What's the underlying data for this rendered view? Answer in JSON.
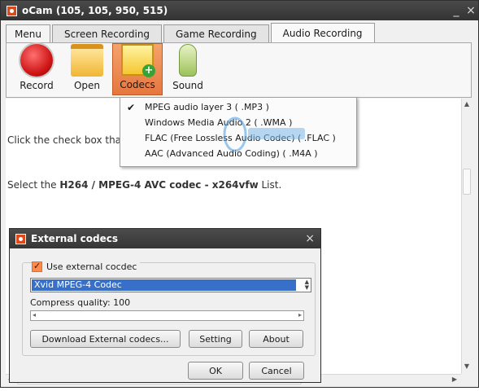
{
  "window": {
    "title": "oCam (105, 105, 950, 515)",
    "minimize": "_",
    "close": "×"
  },
  "menu_tabs": [
    {
      "label": "Menu"
    },
    {
      "label": "Screen Recording"
    },
    {
      "label": "Game Recording"
    },
    {
      "label": "Audio Recording",
      "active": true
    }
  ],
  "toolbar": [
    {
      "label": "Record",
      "icon": "record-icon"
    },
    {
      "label": "Open",
      "icon": "folder-icon"
    },
    {
      "label": "Codecs",
      "icon": "codecs-icon",
      "selected": true
    },
    {
      "label": "Sound",
      "icon": "microphone-icon"
    }
  ],
  "dropdown": {
    "items": [
      {
        "label": "MPEG audio layer 3 ( .MP3 )",
        "checked": true
      },
      {
        "label": "Windows Media Audio 2 ( .WMA )",
        "checked": false
      },
      {
        "label": "FLAC (Free Lossless Audio Codec) ( .FLAC )",
        "checked": false
      },
      {
        "label": "AAC (Advanced Audio Coding) ( .M4A )",
        "checked": false
      }
    ]
  },
  "content": {
    "line1": "Click the check box that",
    "line2_pre": "Select the ",
    "line2_bold": "H264 / MPEG-4 AVC codec - x264vfw",
    "line2_post": " List."
  },
  "dialog": {
    "title": "External codecs",
    "close": "×",
    "use_external_label": "Use external cocdec",
    "use_external_checked": true,
    "codec_selected": "Xvid MPEG-4 Codec",
    "quality_label": "Compress quality: 100",
    "quality_value": 100,
    "download_button": "Download External codecs...",
    "setting_button": "Setting",
    "about_button": "About",
    "ok_button": "OK",
    "cancel_button": "Cancel"
  },
  "colors": {
    "titlebar": "#3d3d3d",
    "selected_tool": "#e87c44",
    "selection": "#3870c9"
  }
}
